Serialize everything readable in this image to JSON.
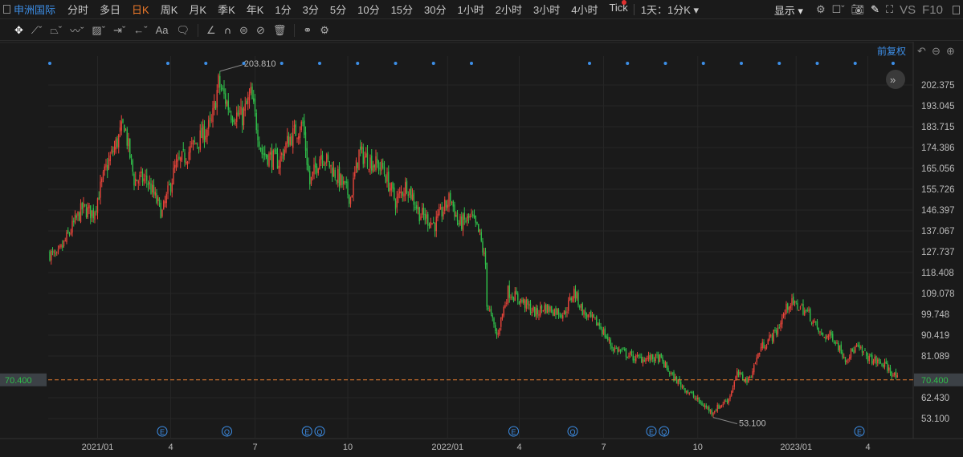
{
  "top": {
    "stock": "申洲国际",
    "periods": [
      "分时",
      "多日",
      "日K",
      "周K",
      "月K",
      "季K",
      "年K",
      "1分",
      "3分",
      "5分",
      "10分",
      "15分",
      "30分",
      "1小时",
      "2小时",
      "3小时",
      "4小时",
      "Tick"
    ],
    "active": "日K",
    "interval": "1天：1分K ▾",
    "display": "显示 ▾",
    "vs": "VS",
    "f10": "F10"
  },
  "tools": {
    "text_tool": "Aa"
  },
  "chart": {
    "adjust": "前复权",
    "last_price": "70.400",
    "high_label": "203.810",
    "low_label": "53.100",
    "colors": {
      "up": "#e8443a",
      "down": "#2fbf4a",
      "accent": "#3d8fe8"
    }
  },
  "chart_data": {
    "type": "candlestick",
    "ylim": [
      48,
      210
    ],
    "yticks": [
      "202.375",
      "193.045",
      "183.715",
      "174.386",
      "165.056",
      "155.726",
      "146.397",
      "137.067",
      "127.737",
      "118.408",
      "109.078",
      "99.748",
      "90.419",
      "81.089",
      "62.430",
      "53.100"
    ],
    "yvals": [
      202.375,
      193.045,
      183.715,
      174.386,
      165.056,
      155.726,
      146.397,
      137.067,
      127.737,
      118.408,
      109.078,
      99.748,
      90.419,
      81.089,
      62.43,
      53.1
    ],
    "xticks": [
      {
        "label": "2021/01",
        "bar": 34
      },
      {
        "label": "4",
        "bar": 86
      },
      {
        "label": "7",
        "bar": 146
      },
      {
        "label": "10",
        "bar": 212
      },
      {
        "label": "2022/01",
        "bar": 283
      },
      {
        "label": "4",
        "bar": 334
      },
      {
        "label": "7",
        "bar": 394
      },
      {
        "label": "10",
        "bar": 461
      },
      {
        "label": "2023/01",
        "bar": 531
      },
      {
        "label": "4",
        "bar": 582
      }
    ],
    "nbars": 604,
    "path": [
      [
        0,
        127
      ],
      [
        5,
        125
      ],
      [
        17,
        140
      ],
      [
        23,
        147
      ],
      [
        31,
        145
      ],
      [
        40,
        165
      ],
      [
        53,
        185
      ],
      [
        60,
        160
      ],
      [
        69,
        160
      ],
      [
        80,
        145
      ],
      [
        89,
        165
      ],
      [
        106,
        178
      ],
      [
        115,
        185
      ],
      [
        120,
        203
      ],
      [
        129,
        190
      ],
      [
        137,
        188
      ],
      [
        143,
        198
      ],
      [
        151,
        172
      ],
      [
        163,
        168
      ],
      [
        170,
        178
      ],
      [
        180,
        185
      ],
      [
        185,
        158
      ],
      [
        193,
        172
      ],
      [
        206,
        160
      ],
      [
        214,
        152
      ],
      [
        220,
        172
      ],
      [
        229,
        168
      ],
      [
        237,
        165
      ],
      [
        246,
        150
      ],
      [
        254,
        158
      ],
      [
        263,
        145
      ],
      [
        274,
        140
      ],
      [
        285,
        152
      ],
      [
        291,
        140
      ],
      [
        300,
        143
      ],
      [
        306,
        135
      ],
      [
        310,
        122
      ],
      [
        311,
        105
      ],
      [
        318,
        90
      ],
      [
        326,
        110
      ],
      [
        337,
        105
      ],
      [
        346,
        100
      ],
      [
        351,
        103
      ],
      [
        366,
        100
      ],
      [
        373,
        110
      ],
      [
        380,
        100
      ],
      [
        391,
        95
      ],
      [
        400,
        85
      ],
      [
        417,
        80
      ],
      [
        426,
        80
      ],
      [
        434,
        80
      ],
      [
        443,
        72
      ],
      [
        451,
        67
      ],
      [
        463,
        60
      ],
      [
        471,
        56
      ],
      [
        483,
        62
      ],
      [
        489,
        73
      ],
      [
        497,
        70
      ],
      [
        506,
        85
      ],
      [
        517,
        92
      ],
      [
        526,
        105
      ],
      [
        534,
        103
      ],
      [
        540,
        100
      ],
      [
        549,
        90
      ],
      [
        557,
        90
      ],
      [
        566,
        80
      ],
      [
        574,
        85
      ],
      [
        583,
        80
      ],
      [
        594,
        77
      ],
      [
        603,
        71
      ]
    ],
    "events": [
      {
        "label": "E",
        "bar": 80
      },
      {
        "label": "Q",
        "bar": 126
      },
      {
        "label": "E",
        "bar": 183
      },
      {
        "label": "Q",
        "bar": 192
      },
      {
        "label": "E",
        "bar": 330
      },
      {
        "label": "Q",
        "bar": 372
      },
      {
        "label": "E",
        "bar": 428
      },
      {
        "label": "Q",
        "bar": 437
      },
      {
        "label": "E",
        "bar": 576
      }
    ]
  }
}
